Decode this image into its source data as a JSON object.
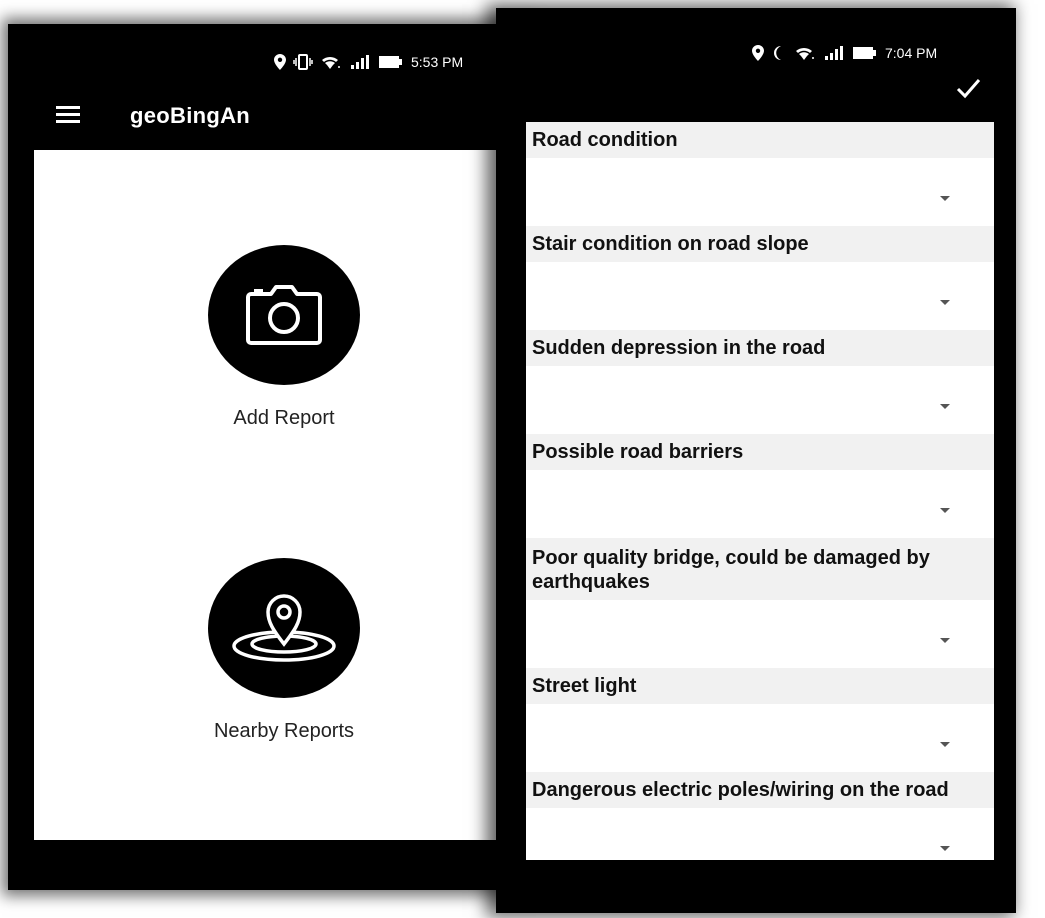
{
  "phone1": {
    "status": {
      "time": "5:53 PM"
    },
    "appbar": {
      "title": "geoBingAn"
    },
    "actions": {
      "add_report": "Add Report",
      "nearby_reports": "Nearby Reports"
    }
  },
  "phone2": {
    "status": {
      "time": "7:04 PM"
    },
    "fields": [
      {
        "label": "Road condition",
        "value": ""
      },
      {
        "label": "Stair condition on road slope",
        "value": ""
      },
      {
        "label": "Sudden depression in the road",
        "value": ""
      },
      {
        "label": "Possible road barriers",
        "value": ""
      },
      {
        "label": "Poor quality bridge, could be damaged by earthquakes",
        "value": ""
      },
      {
        "label": "Street light",
        "value": ""
      },
      {
        "label": "Dangerous electric poles/wiring on the road",
        "value": ""
      }
    ]
  },
  "colors": {
    "appbar": "#000000",
    "content": "#ffffff",
    "label_bg": "#f1f1f1"
  },
  "icons": [
    "location-icon",
    "vibrate-icon",
    "wifi-icon",
    "signal-icon",
    "battery-icon",
    "moon-icon",
    "menu-icon",
    "camera-icon",
    "nearby-location-icon",
    "check-icon",
    "dropdown-arrow-icon"
  ]
}
